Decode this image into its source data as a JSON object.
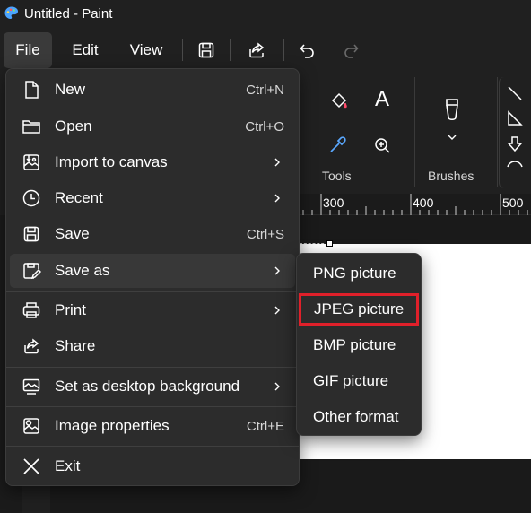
{
  "window": {
    "title": "Untitled - Paint",
    "icon": "paint-palette-icon"
  },
  "menubar": {
    "file": "File",
    "edit": "Edit",
    "view": "View",
    "toolbar_icons": [
      "save-icon",
      "share-icon",
      "undo-icon",
      "redo-icon"
    ]
  },
  "ribbon": {
    "tools_label": "Tools",
    "brushes_label": "Brushes",
    "tool_icons": [
      "fill-bucket-icon",
      "text-icon",
      "color-picker-icon",
      "magnifier-icon"
    ],
    "shape_icons": [
      "line-icon",
      "triangle-icon",
      "arrow-icon",
      "curve-icon"
    ]
  },
  "ruler": {
    "marks": [
      "300",
      "400",
      "500"
    ]
  },
  "file_menu": {
    "items": [
      {
        "label": "New",
        "shortcut": "Ctrl+N",
        "icon": "new-file-icon"
      },
      {
        "label": "Open",
        "shortcut": "Ctrl+O",
        "icon": "folder-icon"
      },
      {
        "label": "Import to canvas",
        "shortcut": "",
        "icon": "import-image-icon",
        "submenu": true
      },
      {
        "label": "Recent",
        "shortcut": "",
        "icon": "clock-icon",
        "submenu": true
      },
      {
        "label": "Save",
        "shortcut": "Ctrl+S",
        "icon": "save-icon"
      },
      {
        "label": "Save as",
        "shortcut": "",
        "icon": "save-as-icon",
        "submenu": true,
        "highlighted": true
      },
      {
        "label": "Print",
        "shortcut": "",
        "icon": "printer-icon",
        "submenu": true
      },
      {
        "label": "Share",
        "shortcut": "",
        "icon": "share-icon"
      },
      {
        "label": "Set as desktop background",
        "shortcut": "",
        "icon": "desktop-background-icon",
        "submenu": true
      },
      {
        "label": "Image properties",
        "shortcut": "Ctrl+E",
        "icon": "image-properties-icon"
      },
      {
        "label": "Exit",
        "shortcut": "",
        "icon": "close-icon"
      }
    ]
  },
  "save_as_menu": {
    "items": [
      "PNG picture",
      "JPEG picture",
      "BMP picture",
      "GIF picture",
      "Other format"
    ],
    "outlined_item": "JPEG picture",
    "outline_color": "#e0202a"
  },
  "colors": {
    "background": "#202020",
    "menu_bg": "#2c2c2c",
    "highlight": "#383838"
  }
}
